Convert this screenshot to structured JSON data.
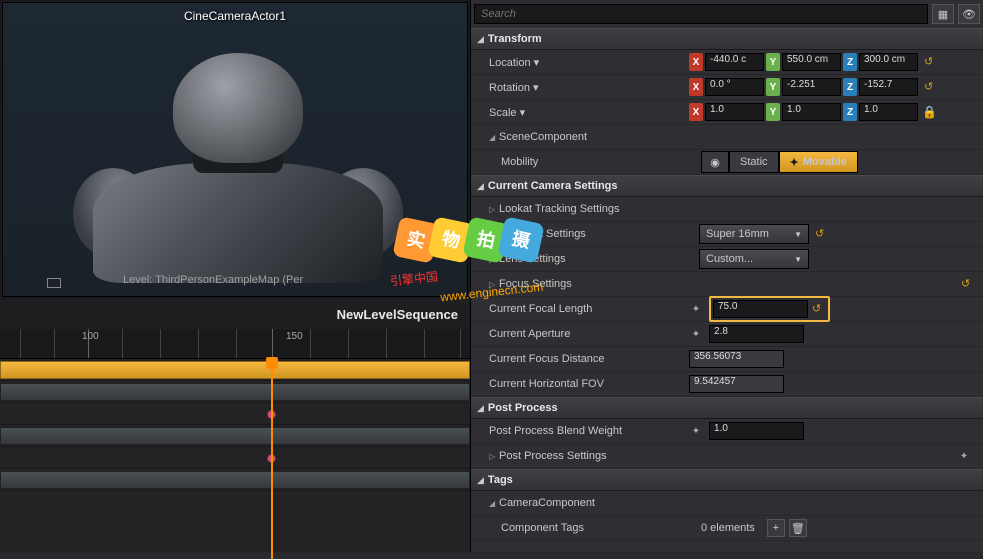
{
  "viewport": {
    "camera_label": "CineCameraActor1",
    "level_text": "Level:  ThirdPersonExampleMap (Per"
  },
  "sequencer": {
    "title": "NewLevelSequence",
    "ticks": [
      "100",
      "150"
    ]
  },
  "search": {
    "placeholder": "Search"
  },
  "sections": {
    "transform": "Transform",
    "scene_component": "SceneComponent",
    "current_camera": "Current Camera Settings",
    "post_process": "Post Process",
    "tags": "Tags",
    "camera_component": "CameraComponent"
  },
  "transform": {
    "location_label": "Location",
    "location": {
      "x": "-440.0 c",
      "y": "550.0 cm",
      "z": "300.0 cm"
    },
    "rotation_label": "Rotation",
    "rotation": {
      "x": "0.0 °",
      "y": "-2.251",
      "z": "-152.7"
    },
    "scale_label": "Scale",
    "scale": {
      "x": "1.0",
      "y": "1.0",
      "z": "1.0"
    },
    "mobility_label": "Mobility",
    "mobility": {
      "static": "Static",
      "movable": "Movable"
    }
  },
  "camera": {
    "lookat": "Lookat Tracking Settings",
    "filmback": "Filmback Settings",
    "filmback_value": "Super 16mm",
    "lens": "Lens Settings",
    "lens_value": "Custom...",
    "focus": "Focus Settings",
    "focal_length_label": "Current Focal Length",
    "focal_length": "75.0",
    "aperture_label": "Current Aperture",
    "aperture": "2.8",
    "focus_dist_label": "Current Focus Distance",
    "focus_dist": "356.56073",
    "hfov_label": "Current Horizontal FOV",
    "hfov": "9.542457"
  },
  "postprocess": {
    "blend_label": "Post Process Blend Weight",
    "blend": "1.0",
    "settings_label": "Post Process Settings"
  },
  "tags": {
    "component_tags_label": "Component Tags",
    "elements": "0 elements"
  },
  "watermark": {
    "chars": [
      "实",
      "物",
      "拍",
      "摄"
    ],
    "line1": "引擎中国",
    "line2": "www.enginecn.com"
  }
}
